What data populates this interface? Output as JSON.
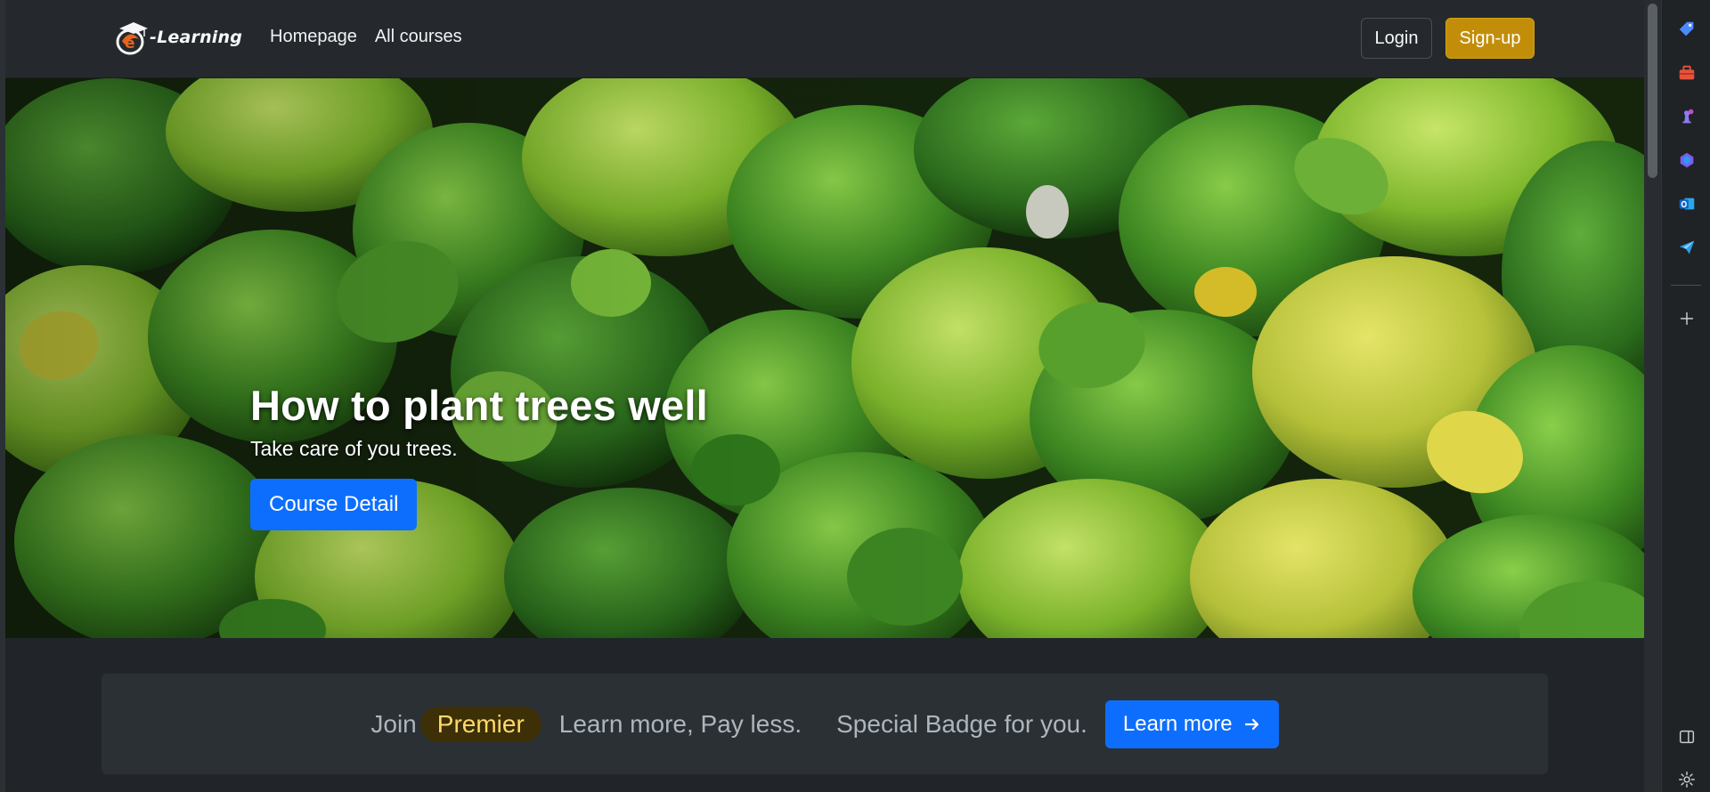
{
  "brand": {
    "name": "-Learning",
    "logo_icon": "graduation-cap-e-logo"
  },
  "nav": {
    "links": [
      "Homepage",
      "All courses"
    ]
  },
  "auth": {
    "login_label": "Login",
    "signup_label": "Sign-up"
  },
  "hero": {
    "title": "How to plant trees well",
    "subtitle": "Take care of you trees.",
    "button_label": "Course Detail",
    "image": "lush green plant wall"
  },
  "promo": {
    "join": "Join",
    "badge": "Premier",
    "text1": "Learn more, Pay less.",
    "text2": "Special Badge for you.",
    "button_label": "Learn more",
    "button_icon": "arrow-right-icon"
  },
  "siderail": {
    "icons": [
      "tag-icon",
      "toolbox-icon",
      "chess-icon",
      "copilot-icon",
      "outlook-icon",
      "paper-plane-icon",
      "plus-icon",
      "sidebar-toggle-icon",
      "settings-gear-icon"
    ]
  },
  "colors": {
    "primary": "#0d6efd",
    "warning": "#c28e0a",
    "premier_text": "#ffda6a",
    "background": "#212529"
  }
}
